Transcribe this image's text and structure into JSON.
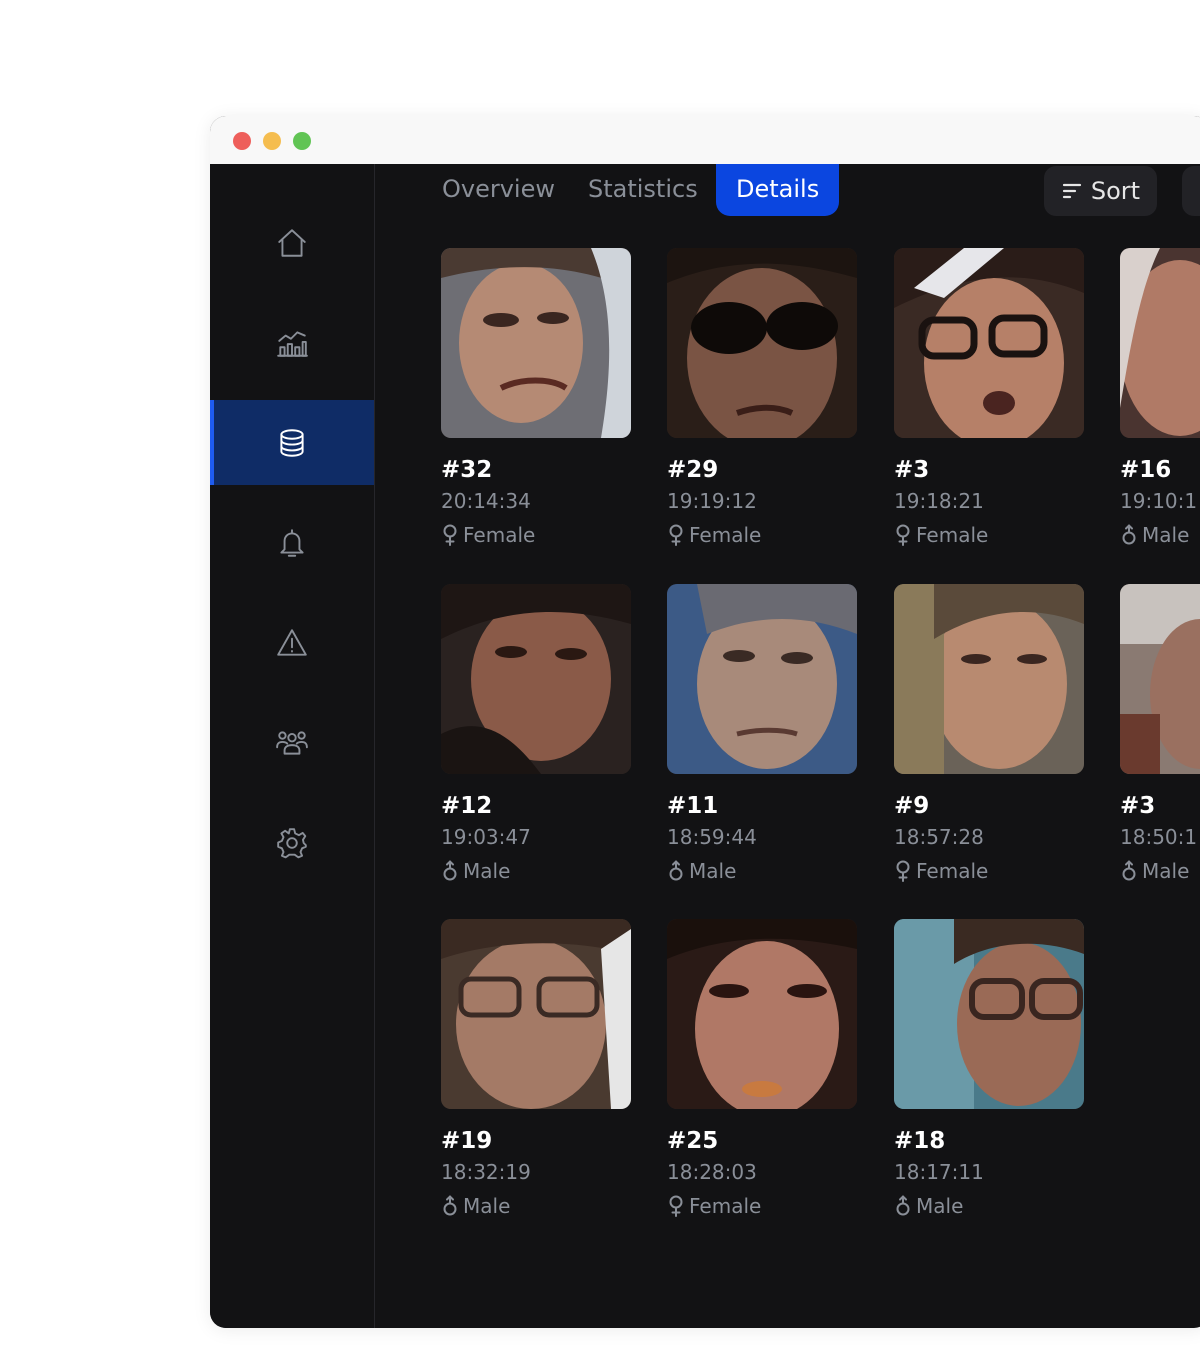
{
  "tabs": [
    {
      "label": "Overview"
    },
    {
      "label": "Statistics"
    },
    {
      "label": "Details"
    }
  ],
  "toolbar": {
    "sort_label": "Sort"
  },
  "sidebar": {
    "items": [
      {
        "icon": "home-icon"
      },
      {
        "icon": "chart-icon"
      },
      {
        "icon": "database-icon",
        "active": true
      },
      {
        "icon": "bell-icon"
      },
      {
        "icon": "warning-icon"
      },
      {
        "icon": "users-icon"
      },
      {
        "icon": "gear-icon"
      }
    ]
  },
  "colors": {
    "accent": "#0b46e0",
    "active_nav": "#0f2c66",
    "background": "#121214"
  },
  "faces": [
    {
      "id": "#32",
      "time": "20:14:34",
      "gender": "Female"
    },
    {
      "id": "#29",
      "time": "19:19:12",
      "gender": "Female"
    },
    {
      "id": "#3",
      "time": "19:18:21",
      "gender": "Female"
    },
    {
      "id": "#16",
      "time": "19:10:1",
      "gender": "Male"
    },
    {
      "id": "#12",
      "time": "19:03:47",
      "gender": "Male"
    },
    {
      "id": "#11",
      "time": "18:59:44",
      "gender": "Male"
    },
    {
      "id": "#9",
      "time": "18:57:28",
      "gender": "Female"
    },
    {
      "id": "#3",
      "time": "18:50:1",
      "gender": "Male"
    },
    {
      "id": "#19",
      "time": "18:32:19",
      "gender": "Male"
    },
    {
      "id": "#25",
      "time": "18:28:03",
      "gender": "Female"
    },
    {
      "id": "#18",
      "time": "18:17:11",
      "gender": "Male"
    }
  ]
}
